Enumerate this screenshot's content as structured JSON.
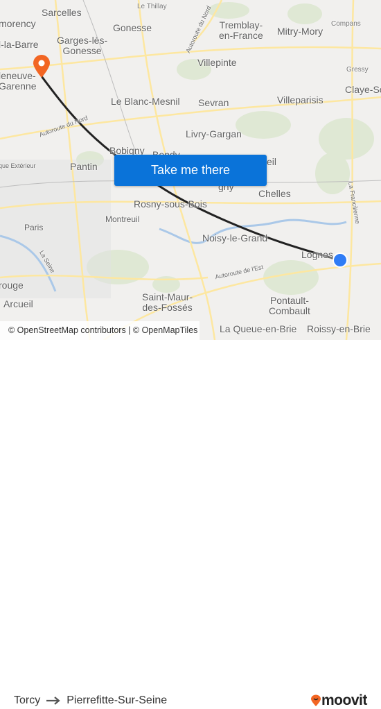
{
  "map": {
    "labels": [
      "Sarcelles",
      "morency",
      "Garges-lès-\nGonesse",
      "Gonesse",
      "Le Thillay",
      "Tremblay-\nen-France",
      "Mitry-Mory",
      "Compans",
      "l-la-Barre",
      "Villepinte",
      "Gressy",
      "Claye-So",
      "leneuve-\nGarenne",
      "Le Blanc-Mesnil",
      "Sevran",
      "Villeparisis",
      "Livry-Gargan",
      "Bobigny",
      "Bondy",
      "Pantin",
      "Chelles",
      "Rosny-sous-Bois",
      "Montreuil",
      "Paris",
      "Noisy-le-Grand",
      "Lognes",
      "rouge",
      "Arcueil",
      "Saint-Maur-\ndes-Fossés",
      "Pontault-\nCombault",
      "La Queue-en-Brie",
      "Roissy-en-Brie",
      "eil",
      "gny"
    ],
    "roads": [
      "Autoroute du Nord",
      "Autoroute du Nord",
      "Autoroute de l'Est",
      "La Francilienne",
      "La Seine",
      "que Extérieur"
    ],
    "attribution": "© OpenStreetMap contributors | © OpenMapTiles",
    "route_color": "#222222",
    "origin_marker_color": "#2f7cf6",
    "destination_pin_color": "#f26522",
    "destination_pin_icon": "pin-icon"
  },
  "cta": {
    "label": "Take me there",
    "color": "#0a73d9"
  },
  "footer": {
    "origin": "Torcy",
    "arrow_icon": "arrow-right-icon",
    "destination": "Pierrefitte-Sur-Seine",
    "brand": "moovit",
    "brand_color": "#f26522"
  }
}
